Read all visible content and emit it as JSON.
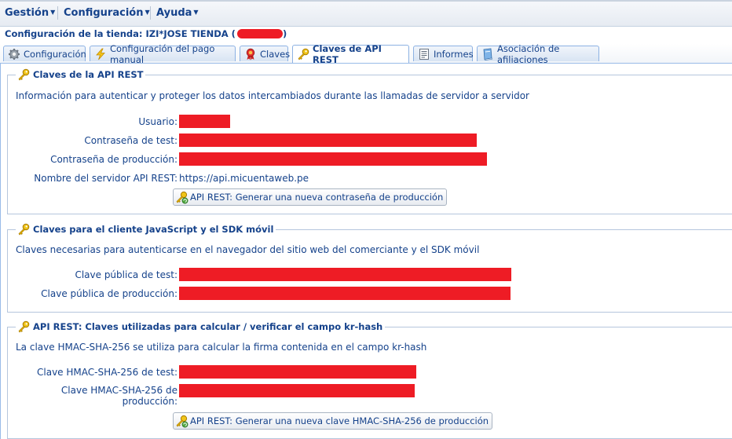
{
  "menu": {
    "items": [
      {
        "label": "Gestión"
      },
      {
        "label": "Configuración"
      },
      {
        "label": "Ayuda"
      }
    ]
  },
  "store": {
    "title": "Configuración de la tienda: IZI*JOSE TIENDA (",
    "close_paren": ")"
  },
  "tabs": [
    {
      "label": "Configuración",
      "icon": "gear-icon"
    },
    {
      "label": "Configuración del pago manual",
      "icon": "lightning-icon"
    },
    {
      "label": "Claves",
      "icon": "ribbon-badge-icon"
    },
    {
      "label": "Claves de API REST",
      "icon": "key-icon",
      "active": true
    },
    {
      "label": "Informes",
      "icon": "report-icon"
    },
    {
      "label": "Asociación de afiliaciones",
      "icon": "book-icon"
    }
  ],
  "sections": {
    "rest": {
      "title": "Claves de la API REST",
      "description": "Información para autenticar y proteger los datos intercambiados durante las llamadas de servidor a servidor",
      "fields": {
        "user_label": "Usuario:",
        "test_password_label": "Contraseña de test:",
        "prod_password_label": "Contraseña de producción:",
        "server_label": "Nombre del servidor API REST:",
        "server_value": "https://api.micuentaweb.pe"
      },
      "button": "API REST: Generar una nueva contraseña de producción"
    },
    "js": {
      "title": "Claves para el cliente JavaScript y el SDK móvil",
      "description": "Claves necesarias para autenticarse en el navegador del sitio web del comerciante y el SDK móvil",
      "fields": {
        "public_test_label": "Clave pública de test:",
        "public_prod_label": "Clave pública de producción:"
      }
    },
    "hmac": {
      "title": "API REST: Claves utilizadas para calcular / verificar el campo kr-hash",
      "description": "La clave HMAC-SHA-256 se utiliza para calcular la firma contenida en el campo kr-hash",
      "fields": {
        "hmac_test_label": "Clave HMAC-SHA-256 de test:",
        "hmac_prod_label_line1": "Clave HMAC-SHA-256 de",
        "hmac_prod_label_line2": "producción:"
      },
      "button": "API REST: Generar una nueva clave HMAC-SHA-256 de producción"
    }
  },
  "colors": {
    "text": "#15428b",
    "redaction": "#ee1c25",
    "tab_border": "#8db2e3"
  }
}
